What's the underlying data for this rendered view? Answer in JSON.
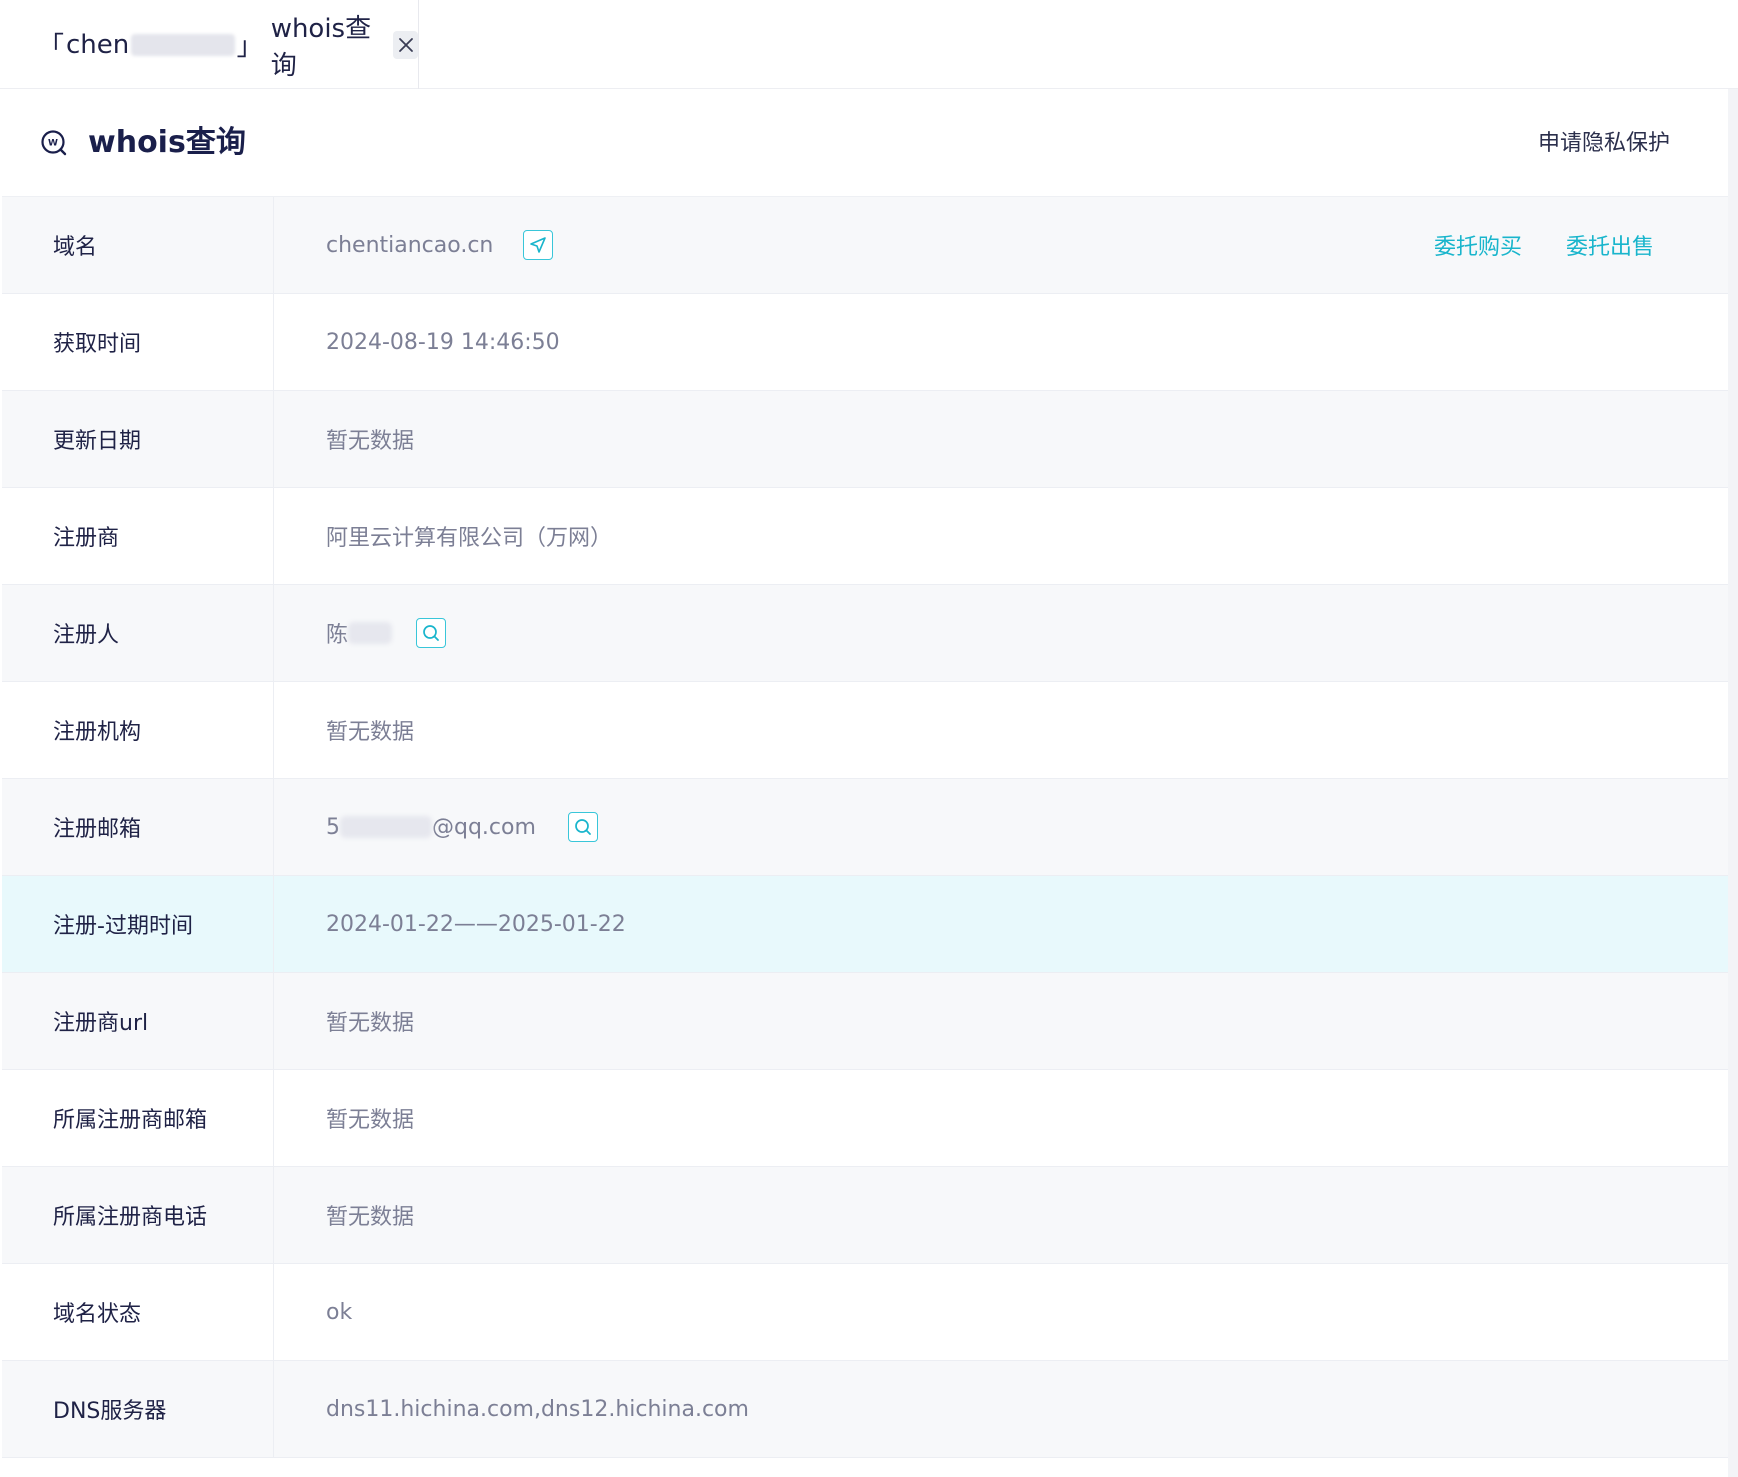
{
  "tab": {
    "open_bracket": "「",
    "domain_prefix": "chen",
    "close_bracket": "」",
    "title": "whois查询"
  },
  "header": {
    "title": "whois查询",
    "privacy_link": "申请隐私保护"
  },
  "rows": [
    {
      "label": "域名",
      "value": "chentiancao.cn"
    },
    {
      "label": "获取时间",
      "value": "2024-08-19 14:46:50"
    },
    {
      "label": "更新日期",
      "value": "暂无数据"
    },
    {
      "label": "注册商",
      "value": "阿里云计算有限公司（万网）"
    },
    {
      "label": "注册人",
      "value": "陈"
    },
    {
      "label": "注册机构",
      "value": "暂无数据"
    },
    {
      "label": "注册邮箱",
      "value_prefix": "5",
      "value_suffix": "@qq.com"
    },
    {
      "label": "注册-过期时间",
      "value": "2024-01-22——2025-01-22"
    },
    {
      "label": "注册商url",
      "value": "暂无数据"
    },
    {
      "label": "所属注册商邮箱",
      "value": "暂无数据"
    },
    {
      "label": "所属注册商电话",
      "value": "暂无数据"
    },
    {
      "label": "域名状态",
      "value": "ok"
    },
    {
      "label": "DNS服务器",
      "value": "dns11.hichina.com,dns12.hichina.com"
    }
  ],
  "domain_actions": {
    "buy": "委托购买",
    "sell": "委托出售"
  },
  "icons": {
    "tab_close": "close-icon",
    "header": "whois-icon",
    "domain_visit": "send-icon",
    "search": "search-icon"
  },
  "colors": {
    "accent": "#19b5cc",
    "title": "#1a1f4b",
    "value_text": "#7c7f95",
    "row_alt": "#f7f8fa",
    "row_highlight": "#e8f9fc"
  }
}
